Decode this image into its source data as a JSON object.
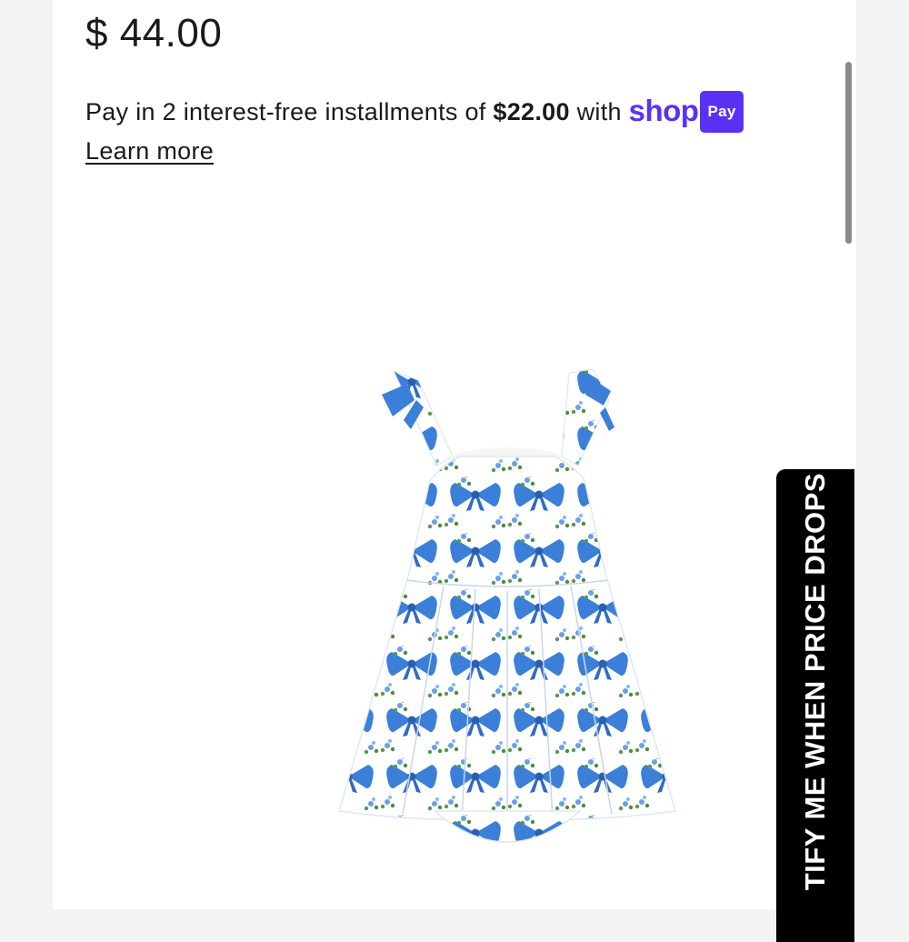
{
  "product": {
    "price": "$ 44.00"
  },
  "shop_pay": {
    "prefix": "Pay in 2 interest-free installments of ",
    "amount": "$22.00",
    "suffix": " with ",
    "brand_word": "shop",
    "badge": "Pay",
    "learn_more": "Learn more",
    "brand_color": "#5a31f4"
  },
  "image": {
    "icon": "product-photo-blue-bow-romper-dress",
    "accent": "#3b7fd9"
  },
  "notify": {
    "label": "TIFY ME WHEN PRICE DROPS"
  }
}
